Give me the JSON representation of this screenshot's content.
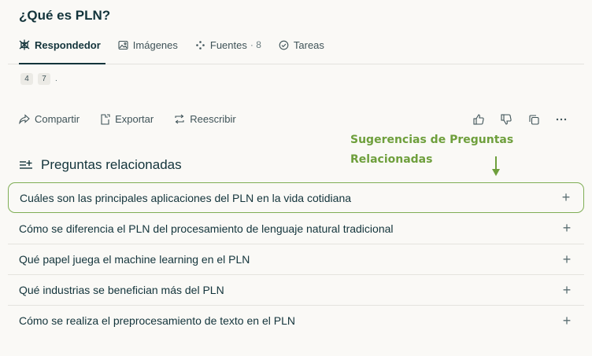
{
  "title": "¿Qué es PLN?",
  "tabs": [
    {
      "label": "Respondedor",
      "icon": "perplexity-icon",
      "active": true
    },
    {
      "label": "Imágenes",
      "icon": "image-icon"
    },
    {
      "label": "Fuentes",
      "icon": "sources-icon",
      "count": "· 8"
    },
    {
      "label": "Tareas",
      "icon": "check-circle-icon"
    }
  ],
  "citations": [
    "4",
    "7"
  ],
  "citation_suffix": ".",
  "actions": [
    {
      "label": "Compartir",
      "icon": "share-icon"
    },
    {
      "label": "Exportar",
      "icon": "export-icon"
    },
    {
      "label": "Reescribir",
      "icon": "rewrite-icon"
    }
  ],
  "right_actions": [
    "thumbs-up-icon",
    "thumbs-down-icon",
    "copy-icon",
    "more-icon"
  ],
  "annotation": {
    "line1": "Sugerencias de Preguntas",
    "line2": "Relacionadas",
    "color": "#6e9f3c"
  },
  "related": {
    "heading": "Preguntas relacionadas",
    "items": [
      "Cuáles son las principales aplicaciones del PLN en la vida cotidiana",
      "Cómo se diferencia el PLN del procesamiento de lenguaje natural tradicional",
      "Qué papel juega el machine learning en el PLN",
      "Qué industrias se benefician más del PLN",
      "Cómo se realiza el preprocesamiento de texto en el PLN"
    ],
    "expand_symbol": "+"
  }
}
